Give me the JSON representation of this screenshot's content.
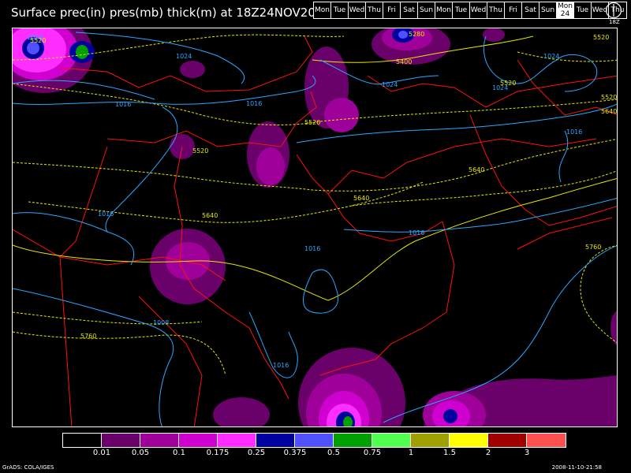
{
  "title": "Surface prec(in) pres(mb) thick(m) at 18Z24NOV2008",
  "days": [
    "Mon",
    "Tue",
    "Wed",
    "Thu",
    "Fri",
    "Sat",
    "Sun",
    "Mon",
    "Tue",
    "Wed",
    "Thu",
    "Fri",
    "Sat",
    "Sun",
    "Mon",
    "Tue",
    "Wed",
    "Thu"
  ],
  "current_day": {
    "index": 14,
    "number": "24"
  },
  "clock_label": "18Z",
  "legend": {
    "colors": [
      "#000000",
      "#6a006a",
      "#a0009a",
      "#d000d0",
      "#ff2dff",
      "#0000a0",
      "#5050ff",
      "#00a000",
      "#50ff50",
      "#a0a000",
      "#ffff00",
      "#a00000",
      "#ff5050"
    ],
    "labels": [
      "0.01",
      "0.05",
      "0.1",
      "0.175",
      "0.25",
      "0.375",
      "0.5",
      "0.75",
      "1",
      "1.5",
      "2",
      "3"
    ],
    "units": "in"
  },
  "isobars_mb": [
    "1024",
    "1016",
    "1024",
    "1016",
    "1016",
    "1016",
    "1016",
    "1008",
    "1016",
    "1024",
    "1016",
    "1016",
    "1024"
  ],
  "thickness_m": [
    "5520",
    "5280",
    "5400",
    "5520",
    "5520",
    "5520",
    "5640",
    "5640",
    "5640",
    "5760",
    "5760",
    "5520",
    "5640",
    "5520"
  ],
  "footer_left": "GrADS: COLA/IGES",
  "footer_right": "2008-11-10-21:58"
}
